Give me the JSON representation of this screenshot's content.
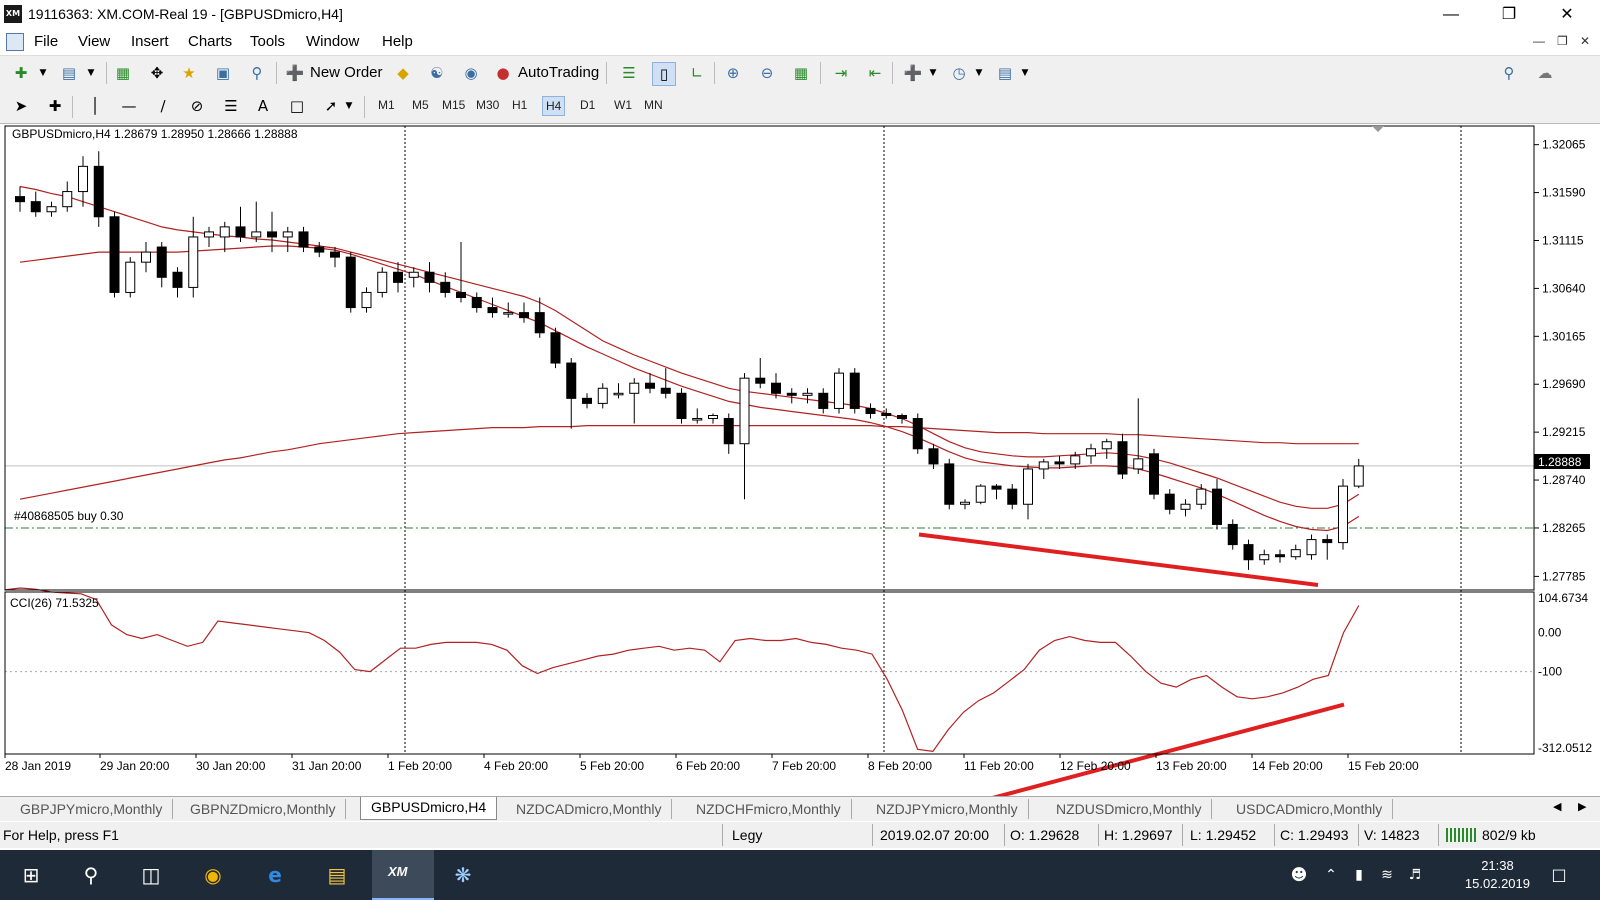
{
  "window": {
    "app_icon": "XM",
    "title": "19116363: XM.COM-Real 19 - [GBPUSDmicro,H4]",
    "buttons": [
      "minimize-icon",
      "maximize-icon",
      "close-icon"
    ]
  },
  "menu": [
    "File",
    "View",
    "Insert",
    "Charts",
    "Tools",
    "Window",
    "Help"
  ],
  "toolbar": {
    "new_order": "New Order",
    "auto_trading": "AutoTrading"
  },
  "timeframes": [
    "M1",
    "M5",
    "M15",
    "M30",
    "H1",
    "H4",
    "D1",
    "W1",
    "MN"
  ],
  "active_timeframe": "H4",
  "chart": {
    "header": "GBPUSDmicro,H4  1.28679 1.28950 1.28666 1.28888",
    "order_label": "#40868505 buy 0.30",
    "current_price": "1.28888",
    "indicator_label": "CCI(26) 71.5325",
    "colors": {
      "bull": "#ffffff",
      "bear": "#000000",
      "ma": "#b22222",
      "trendline": "#e02020",
      "order_line": "#2e7d32"
    }
  },
  "chart_data": {
    "type": "candlestick",
    "price_axis": [
      "1.32065",
      "1.31590",
      "1.31115",
      "1.30640",
      "1.30165",
      "1.29690",
      "1.29215",
      "1.28740",
      "1.28265",
      "1.27785"
    ],
    "ylim": [
      1.2765,
      1.3225
    ],
    "cci_axis": [
      "104.6734",
      "0.00",
      "-100",
      "-312.0512"
    ],
    "time_axis": [
      "28 Jan 2019",
      "29 Jan 20:00",
      "30 Jan 20:00",
      "31 Jan 20:00",
      "1 Feb 20:00",
      "4 Feb 20:00",
      "5 Feb 20:00",
      "6 Feb 20:00",
      "7 Feb 20:00",
      "8 Feb 20:00",
      "11 Feb 20:00",
      "12 Feb 20:00",
      "13 Feb 20:00",
      "14 Feb 20:00",
      "15 Feb 20:00"
    ],
    "order_price": 1.28265,
    "candles": [
      [
        1.3155,
        1.3165,
        1.314,
        1.315
      ],
      [
        1.315,
        1.316,
        1.3135,
        1.314
      ],
      [
        1.314,
        1.315,
        1.3135,
        1.3145
      ],
      [
        1.3145,
        1.317,
        1.314,
        1.316
      ],
      [
        1.316,
        1.3195,
        1.3145,
        1.3185
      ],
      [
        1.3185,
        1.32,
        1.3125,
        1.3135
      ],
      [
        1.3135,
        1.314,
        1.3055,
        1.306
      ],
      [
        1.306,
        1.3095,
        1.3055,
        1.309
      ],
      [
        1.309,
        1.311,
        1.308,
        1.31
      ],
      [
        1.3105,
        1.311,
        1.3065,
        1.3075
      ],
      [
        1.308,
        1.3085,
        1.3055,
        1.3065
      ],
      [
        1.3065,
        1.3135,
        1.3055,
        1.3115
      ],
      [
        1.3115,
        1.3125,
        1.3105,
        1.312
      ],
      [
        1.3115,
        1.313,
        1.31,
        1.3125
      ],
      [
        1.3125,
        1.3145,
        1.311,
        1.3115
      ],
      [
        1.3115,
        1.315,
        1.311,
        1.312
      ],
      [
        1.312,
        1.314,
        1.31,
        1.3115
      ],
      [
        1.3115,
        1.3125,
        1.31,
        1.312
      ],
      [
        1.312,
        1.3125,
        1.31,
        1.3105
      ],
      [
        1.3105,
        1.311,
        1.3095,
        1.31
      ],
      [
        1.31,
        1.3105,
        1.3085,
        1.3095
      ],
      [
        1.3095,
        1.31,
        1.304,
        1.3045
      ],
      [
        1.3045,
        1.3065,
        1.304,
        1.306
      ],
      [
        1.306,
        1.3085,
        1.3055,
        1.308
      ],
      [
        1.308,
        1.309,
        1.306,
        1.307
      ],
      [
        1.3075,
        1.3085,
        1.3065,
        1.308
      ],
      [
        1.308,
        1.309,
        1.306,
        1.307
      ],
      [
        1.307,
        1.308,
        1.3055,
        1.306
      ],
      [
        1.306,
        1.311,
        1.305,
        1.3055
      ],
      [
        1.3055,
        1.306,
        1.304,
        1.3045
      ],
      [
        1.3045,
        1.3055,
        1.3035,
        1.304
      ],
      [
        1.304,
        1.305,
        1.3035,
        1.304
      ],
      [
        1.304,
        1.305,
        1.303,
        1.3035
      ],
      [
        1.304,
        1.3055,
        1.3015,
        1.302
      ],
      [
        1.302,
        1.3025,
        1.2985,
        1.299
      ],
      [
        1.299,
        1.2995,
        1.2925,
        1.2955
      ],
      [
        1.2955,
        1.296,
        1.2945,
        1.295
      ],
      [
        1.295,
        1.297,
        1.2945,
        1.2965
      ],
      [
        1.296,
        1.297,
        1.2955,
        1.296
      ],
      [
        1.296,
        1.2975,
        1.293,
        1.297
      ],
      [
        1.297,
        1.298,
        1.296,
        1.2965
      ],
      [
        1.2965,
        1.2985,
        1.2955,
        1.296
      ],
      [
        1.296,
        1.2965,
        1.293,
        1.2935
      ],
      [
        1.2935,
        1.2945,
        1.293,
        1.2935
      ],
      [
        1.2935,
        1.294,
        1.293,
        1.2938
      ],
      [
        1.2935,
        1.294,
        1.29,
        1.291
      ],
      [
        1.291,
        1.298,
        1.2855,
        1.2975
      ],
      [
        1.2975,
        1.2995,
        1.2965,
        1.297
      ],
      [
        1.297,
        1.298,
        1.2955,
        1.296
      ],
      [
        1.296,
        1.2965,
        1.295,
        1.2958
      ],
      [
        1.2958,
        1.2965,
        1.295,
        1.296
      ],
      [
        1.296,
        1.2965,
        1.294,
        1.2945
      ],
      [
        1.2945,
        1.2985,
        1.294,
        1.298
      ],
      [
        1.298,
        1.2985,
        1.294,
        1.2945
      ],
      [
        1.2945,
        1.295,
        1.2935,
        1.294
      ],
      [
        1.294,
        1.2945,
        1.2935,
        1.2938
      ],
      [
        1.2938,
        1.294,
        1.293,
        1.2935
      ],
      [
        1.2935,
        1.294,
        1.29,
        1.2905
      ],
      [
        1.2905,
        1.291,
        1.2885,
        1.289
      ],
      [
        1.289,
        1.2895,
        1.2845,
        1.285
      ],
      [
        1.285,
        1.2855,
        1.2845,
        1.2852
      ],
      [
        1.2852,
        1.287,
        1.285,
        1.2868
      ],
      [
        1.2868,
        1.287,
        1.2855,
        1.2865
      ],
      [
        1.2865,
        1.287,
        1.2845,
        1.285
      ],
      [
        1.285,
        1.289,
        1.2835,
        1.2885
      ],
      [
        1.2885,
        1.2895,
        1.2875,
        1.2892
      ],
      [
        1.2892,
        1.2898,
        1.2885,
        1.289
      ],
      [
        1.289,
        1.2902,
        1.2885,
        1.2898
      ],
      [
        1.2898,
        1.291,
        1.289,
        1.2905
      ],
      [
        1.2905,
        1.2915,
        1.2895,
        1.2912
      ],
      [
        1.2912,
        1.292,
        1.2875,
        1.288
      ],
      [
        1.2885,
        1.2955,
        1.288,
        1.2895
      ],
      [
        1.29,
        1.2905,
        1.2855,
        1.286
      ],
      [
        1.286,
        1.2865,
        1.284,
        1.2845
      ],
      [
        1.2845,
        1.2855,
        1.2838,
        1.285
      ],
      [
        1.285,
        1.287,
        1.2845,
        1.2865
      ],
      [
        1.2865,
        1.2875,
        1.2825,
        1.283
      ],
      [
        1.283,
        1.2835,
        1.2805,
        1.281
      ],
      [
        1.281,
        1.2815,
        1.2785,
        1.2795
      ],
      [
        1.2795,
        1.2805,
        1.279,
        1.28
      ],
      [
        1.28,
        1.2805,
        1.2792,
        1.2798
      ],
      [
        1.2798,
        1.281,
        1.2795,
        1.2805
      ],
      [
        1.28,
        1.282,
        1.2795,
        1.2815
      ],
      [
        1.2815,
        1.282,
        1.2795,
        1.2812
      ],
      [
        1.2812,
        1.2875,
        1.2805,
        1.2868
      ],
      [
        1.2868,
        1.2895,
        1.2866,
        1.2888
      ]
    ],
    "ma_long": [
      1.2855,
      1.2858,
      1.2861,
      1.2864,
      1.2867,
      1.287,
      1.2873,
      1.2876,
      1.2879,
      1.2882,
      1.2885,
      1.2888,
      1.2891,
      1.2894,
      1.2896,
      1.2899,
      1.2902,
      1.2904,
      1.2907,
      1.291,
      1.2912,
      1.2914,
      1.2916,
      1.2918,
      1.292,
      1.2921,
      1.2922,
      1.2923,
      1.2924,
      1.2925,
      1.2926,
      1.2926,
      1.2926,
      1.2927,
      1.2927,
      1.2927,
      1.2928,
      1.2928,
      1.2928,
      1.2928,
      1.2928,
      1.2928,
      1.2928,
      1.2928,
      1.2928,
      1.2928,
      1.2928,
      1.2928,
      1.2928,
      1.2928,
      1.2928,
      1.2928,
      1.2928,
      1.2928,
      1.2928,
      1.2927,
      1.2927,
      1.2926,
      1.2925,
      1.2924,
      1.2923,
      1.2922,
      1.2921,
      1.2921,
      1.2921,
      1.292,
      1.292,
      1.292,
      1.292,
      1.292,
      1.2919,
      1.2919,
      1.2918,
      1.2917,
      1.2916,
      1.2915,
      1.2914,
      1.2913,
      1.2912,
      1.2911,
      1.2911,
      1.291,
      1.291,
      1.291,
      1.291,
      1.291
    ],
    "ma_fast": [
      1.3165,
      1.3162,
      1.3158,
      1.3155,
      1.315,
      1.3145,
      1.314,
      1.3135,
      1.313,
      1.3125,
      1.3122,
      1.312,
      1.3118,
      1.3116,
      1.3115,
      1.3113,
      1.3112,
      1.311,
      1.3108,
      1.3106,
      1.3104,
      1.31,
      1.3096,
      1.3092,
      1.3088,
      1.3084,
      1.308,
      1.3076,
      1.3072,
      1.3068,
      1.3064,
      1.306,
      1.3056,
      1.305,
      1.3042,
      1.3032,
      1.3022,
      1.3012,
      1.3005,
      1.2998,
      1.2992,
      1.2986,
      1.298,
      1.2975,
      1.297,
      1.2965,
      1.2962,
      1.296,
      1.2958,
      1.2956,
      1.2954,
      1.2952,
      1.295,
      1.2948,
      1.2945,
      1.294,
      1.2935,
      1.2928,
      1.292,
      1.2912,
      1.2906,
      1.2902,
      1.29,
      1.2898,
      1.2897,
      1.2897,
      1.2898,
      1.2899,
      1.29,
      1.2901,
      1.29,
      1.2898,
      1.2895,
      1.2891,
      1.2886,
      1.2881,
      1.2876,
      1.287,
      1.2864,
      1.2858,
      1.2852,
      1.2848,
      1.2846,
      1.2846,
      1.285,
      1.286
    ],
    "ma_slow": [
      1.309,
      1.3092,
      1.3094,
      1.3096,
      1.3098,
      1.31,
      1.31,
      1.31,
      1.31,
      1.31,
      1.31,
      1.3101,
      1.3102,
      1.3103,
      1.3104,
      1.3105,
      1.3106,
      1.3106,
      1.3105,
      1.3104,
      1.3102,
      1.3098,
      1.3093,
      1.3088,
      1.3083,
      1.3078,
      1.3072,
      1.3066,
      1.306,
      1.3054,
      1.3048,
      1.3042,
      1.3036,
      1.303,
      1.3022,
      1.3014,
      1.3006,
      1.2999,
      1.2992,
      1.2985,
      1.2979,
      1.2973,
      1.2967,
      1.2962,
      1.2957,
      1.2952,
      1.2949,
      1.2946,
      1.2944,
      1.2942,
      1.294,
      1.2938,
      1.2936,
      1.2934,
      1.2931,
      1.2927,
      1.2922,
      1.2916,
      1.2909,
      1.2902,
      1.2896,
      1.2892,
      1.289,
      1.2888,
      1.2887,
      1.2886,
      1.2886,
      1.2887,
      1.2888,
      1.2888,
      1.2887,
      1.2885,
      1.2881,
      1.2876,
      1.2871,
      1.2866,
      1.286,
      1.2853,
      1.2846,
      1.2839,
      1.2833,
      1.2828,
      1.2825,
      1.2824,
      1.2828,
      1.2838
    ],
    "cci": [
      110,
      115,
      112,
      105,
      102,
      100,
      85,
      20,
      -5,
      -15,
      -5,
      -20,
      -35,
      -25,
      30,
      25,
      20,
      15,
      10,
      5,
      0,
      -20,
      -50,
      -95,
      -100,
      -70,
      -40,
      -40,
      -30,
      -25,
      -25,
      -25,
      -30,
      -45,
      -85,
      -105,
      -90,
      -80,
      -70,
      -60,
      -55,
      -45,
      -40,
      -35,
      -45,
      -40,
      -45,
      -75,
      -20,
      -15,
      -20,
      -20,
      -15,
      -25,
      -30,
      -40,
      -45,
      -55,
      -120,
      -200,
      -300,
      -305,
      -250,
      -205,
      -175,
      -155,
      -125,
      -95,
      -45,
      -20,
      -10,
      -20,
      -25,
      -25,
      -60,
      -100,
      -130,
      -140,
      -120,
      -110,
      -140,
      -165,
      -170,
      -165,
      -155,
      -140,
      -120,
      -110,
      0,
      70
    ],
    "trendline_price": [
      1.282,
      1.277
    ],
    "trendline_cci": [
      -450,
      -185
    ]
  },
  "tabs": [
    "GBPJPYmicro,Monthly",
    "GBPNZDmicro,Monthly",
    "GBPUSDmicro,H4",
    "NZDCADmicro,Monthly",
    "NZDCHFmicro,Monthly",
    "NZDJPYmicro,Monthly",
    "NZDUSDmicro,Monthly",
    "USDCADmicro,Monthly"
  ],
  "active_tab": "GBPUSDmicro,H4",
  "status": {
    "help": "For Help, press F1",
    "profile": "Legy",
    "datetime": "2019.02.07 20:00",
    "open": "O: 1.29628",
    "high": "H: 1.29697",
    "low": "L: 1.29452",
    "close": "C: 1.29493",
    "volume": "V: 14823",
    "traffic": "802/9 kb"
  },
  "taskbar": {
    "time": "21:38",
    "date": "15.02.2019",
    "xm_label": "XM"
  }
}
